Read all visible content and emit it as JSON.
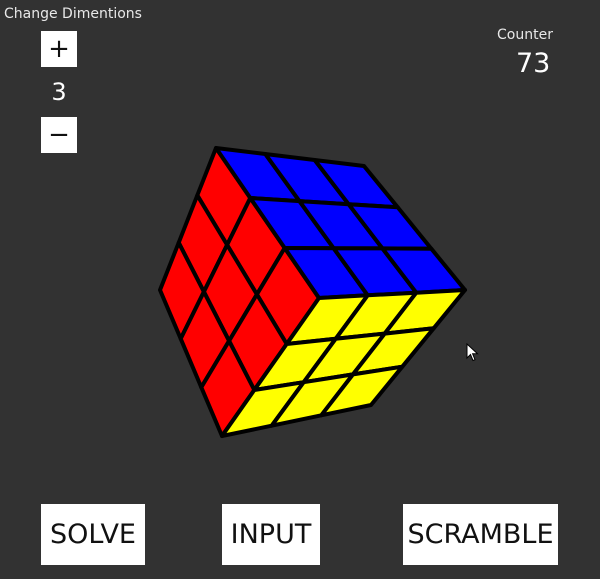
{
  "dimensions": {
    "label": "Change Dimentions",
    "plus_label": "+",
    "value": "3",
    "minus_label": "−"
  },
  "counter": {
    "label": "Counter",
    "value": "73"
  },
  "cube": {
    "size": 3,
    "faces": {
      "left": "red",
      "top": "blue",
      "front": "yellow"
    },
    "colors": {
      "red": "#ff0000",
      "blue": "#0000ff",
      "yellow": "#ffff00",
      "edge": "#000000",
      "background": "#323232"
    }
  },
  "actions": {
    "solve_label": "SOLVE",
    "input_label": "INPUT",
    "scramble_label": "SCRAMBLE"
  }
}
